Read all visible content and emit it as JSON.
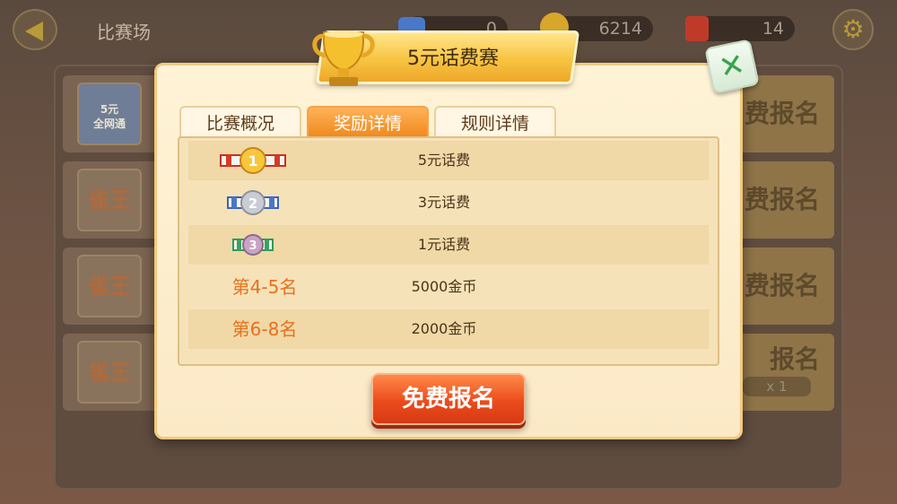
{
  "background": {
    "screen_title": "比赛场",
    "resources": [
      {
        "icon": "gem-icon",
        "value": "0",
        "color": "#4a78c8"
      },
      {
        "icon": "coin-icon",
        "value": "6214",
        "color": "#d8a62a"
      },
      {
        "icon": "ticket-icon",
        "value": "14",
        "color": "#c03a2a"
      }
    ],
    "rows": [
      {
        "thumb_label": "5元\n全网通",
        "button": "费报名"
      },
      {
        "thumb_label": "雀王",
        "button": "费报名"
      },
      {
        "thumb_label": "雀王",
        "button": "费报名"
      },
      {
        "thumb_label": "雀王",
        "button": "报名",
        "sub": "x 1"
      }
    ]
  },
  "dialog": {
    "title": "5元话费赛",
    "tabs": [
      {
        "label": "比赛概况",
        "active": false
      },
      {
        "label": "奖励详情",
        "active": true
      },
      {
        "label": "规则详情",
        "active": false
      }
    ],
    "rewards": [
      {
        "rank_icon": "gold-medal-1-icon",
        "prize": "5元话费"
      },
      {
        "rank_icon": "silver-medal-2-icon",
        "prize": "3元话费"
      },
      {
        "rank_icon": "bronze-medal-3-icon",
        "prize": "1元话费"
      },
      {
        "rank": "第4-5名",
        "prize": "5000金币"
      },
      {
        "rank": "第6-8名",
        "prize": "2000金币"
      }
    ],
    "signup_button": "免费报名"
  },
  "colors": {
    "accent_orange": "#f08a1e",
    "signup_red": "#ec4c1c",
    "banner_gold": "#f7c441",
    "rank_text": "#e6721f"
  }
}
